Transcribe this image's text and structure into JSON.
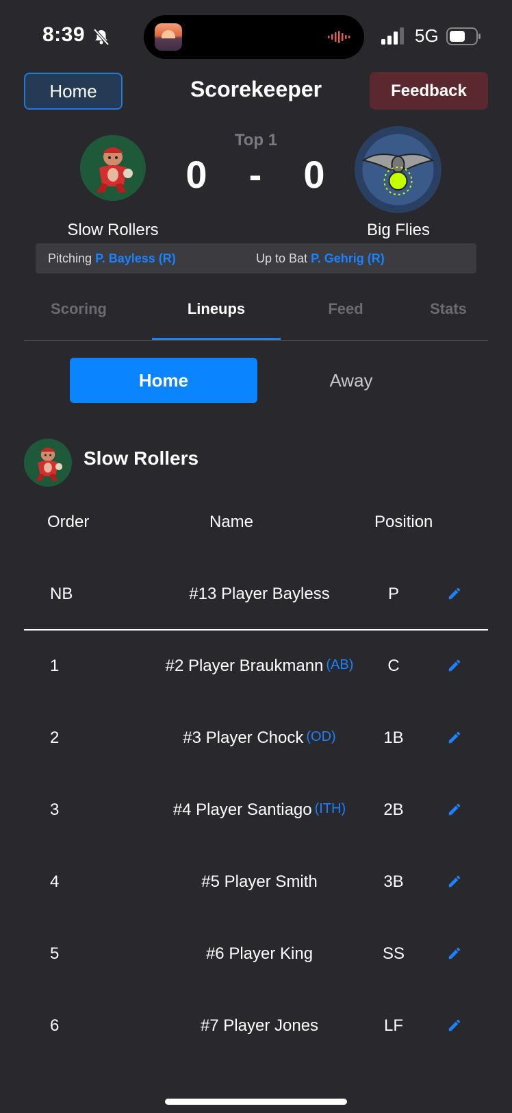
{
  "status": {
    "time": "8:39",
    "network": "5G"
  },
  "header": {
    "home_label": "Home",
    "title": "Scorekeeper",
    "feedback_label": "Feedback"
  },
  "scoreboard": {
    "inning": "Top 1",
    "home_score": "0",
    "separator": "-",
    "away_score": "0",
    "home_team": "Slow Rollers",
    "away_team": "Big Flies"
  },
  "info": {
    "pitching_label": "Pitching",
    "pitcher": "P. Bayless (R)",
    "batting_label": "Up to Bat",
    "batter": "P. Gehrig (R)"
  },
  "tabs": [
    {
      "label": "Scoring",
      "active": false
    },
    {
      "label": "Lineups",
      "active": true
    },
    {
      "label": "Feed",
      "active": false
    },
    {
      "label": "Stats",
      "active": false
    }
  ],
  "segment": {
    "home": "Home",
    "away": "Away",
    "selected": "Home"
  },
  "lineup": {
    "team": "Slow Rollers",
    "columns": {
      "order": "Order",
      "name": "Name",
      "position": "Position"
    },
    "rows": [
      {
        "order": "NB",
        "name": "#13 Player Bayless",
        "tag": "",
        "position": "P"
      },
      {
        "order": "1",
        "name": "#2 Player Braukmann",
        "tag": "(AB)",
        "position": "C"
      },
      {
        "order": "2",
        "name": "#3 Player Chock",
        "tag": "(OD)",
        "position": "1B"
      },
      {
        "order": "3",
        "name": "#4 Player Santiago",
        "tag": "(ITH)",
        "position": "2B"
      },
      {
        "order": "4",
        "name": "#5 Player Smith",
        "tag": "",
        "position": "3B"
      },
      {
        "order": "5",
        "name": "#6 Player King",
        "tag": "",
        "position": "SS"
      },
      {
        "order": "6",
        "name": "#7 Player Jones",
        "tag": "",
        "position": "LF"
      }
    ]
  },
  "colors": {
    "accent": "#0a84ff",
    "background": "#28282d",
    "feedback": "#5b2830"
  }
}
